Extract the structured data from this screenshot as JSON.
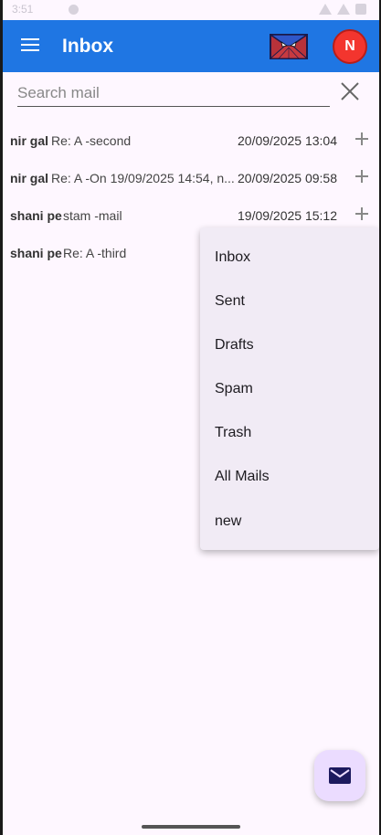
{
  "statusbar": {
    "time": "3:51"
  },
  "appbar": {
    "title": "Inbox"
  },
  "avatar": {
    "letter": "N"
  },
  "search": {
    "placeholder": "Search mail",
    "value": ""
  },
  "mails": [
    {
      "sender": "nir gal",
      "subject": "Re: A -second",
      "date": "20/09/2025 13:04"
    },
    {
      "sender": "nir gal",
      "subject": "Re: A -On 19/09/2025 14:54, n...",
      "date": "20/09/2025 09:58"
    },
    {
      "sender": "shani pe",
      "subject": "stam -mail",
      "date": "19/09/2025 15:12"
    },
    {
      "sender": "shani pe",
      "subject": "Re: A -third",
      "date": ""
    }
  ],
  "menu": {
    "items": [
      "Inbox",
      "Sent",
      "Drafts",
      "Spam",
      "Trash",
      "All Mails",
      "new"
    ]
  },
  "colors": {
    "appbar": "#1f76e3",
    "avatar": "#f3352e",
    "fab": "#ebdcff",
    "fab_icon": "#1c1a5e"
  },
  "icons": {
    "menu": "hamburger-menu-icon",
    "logo": "spiderman-mail-logo-icon",
    "clear": "close-icon",
    "add": "plus-icon",
    "compose": "envelope-icon"
  }
}
